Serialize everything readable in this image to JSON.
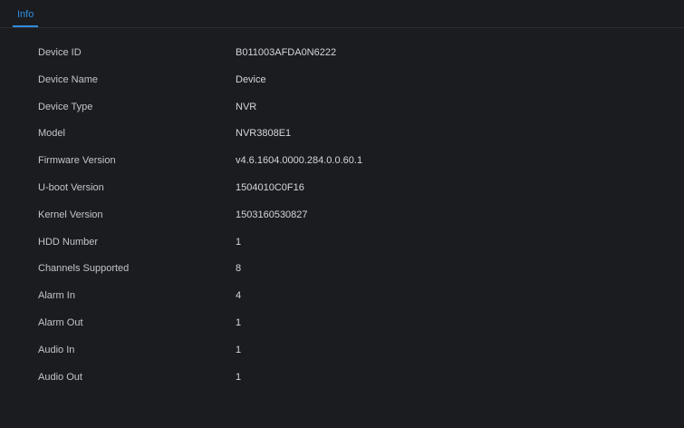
{
  "tabs": [
    {
      "label": "Info",
      "active": true
    }
  ],
  "accent_color": "#2f8ee0",
  "info_rows": [
    {
      "label": "Device ID",
      "value": "B011003AFDA0N6222"
    },
    {
      "label": "Device Name",
      "value": "Device"
    },
    {
      "label": "Device Type",
      "value": "NVR"
    },
    {
      "label": "Model",
      "value": "NVR3808E1"
    },
    {
      "label": "Firmware Version",
      "value": "v4.6.1604.0000.284.0.0.60.1"
    },
    {
      "label": "U-boot Version",
      "value": "1504010C0F16"
    },
    {
      "label": "Kernel Version",
      "value": "1503160530827"
    },
    {
      "label": "HDD Number",
      "value": "1"
    },
    {
      "label": "Channels Supported",
      "value": "8"
    },
    {
      "label": "Alarm In",
      "value": "4"
    },
    {
      "label": "Alarm Out",
      "value": "1"
    },
    {
      "label": "Audio In",
      "value": "1"
    },
    {
      "label": "Audio Out",
      "value": "1"
    }
  ]
}
